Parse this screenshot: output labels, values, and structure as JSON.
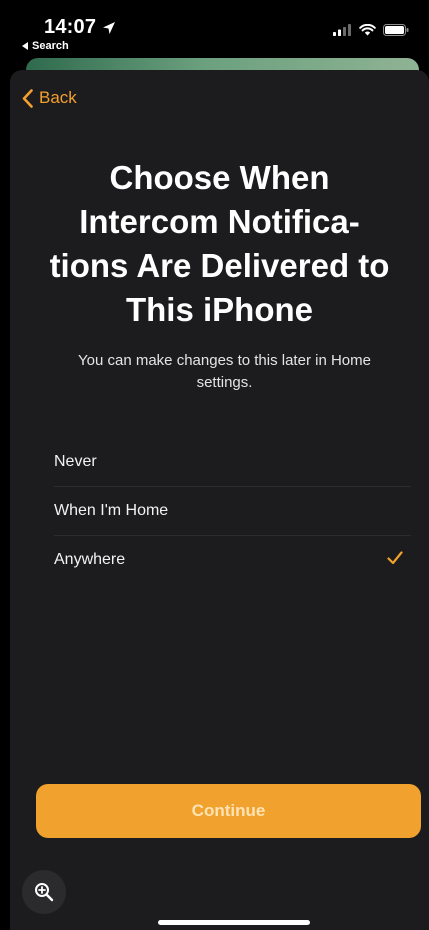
{
  "status_bar": {
    "time": "14:07",
    "back_app": "Search"
  },
  "nav": {
    "back_label": "Back"
  },
  "headline": {
    "lines": [
      "Choose When",
      "Intercom Notifica-",
      "tions Are Delivered to",
      "This iPhone"
    ]
  },
  "subtitle": {
    "lines": [
      "You can make changes to this later in Home",
      "settings."
    ]
  },
  "options": [
    {
      "label": "Never",
      "selected": false
    },
    {
      "label": "When I'm Home",
      "selected": false
    },
    {
      "label": "Anywhere",
      "selected": true
    }
  ],
  "continue_label": "Continue",
  "colors": {
    "accent": "#f0a12e",
    "card_background": "#1c1c1e",
    "screen_background": "#000000"
  },
  "icons": {
    "location": "location-arrow-icon",
    "back": "chevron-left-icon",
    "check": "checkmark-icon",
    "zoom": "zoom-in-icon"
  }
}
